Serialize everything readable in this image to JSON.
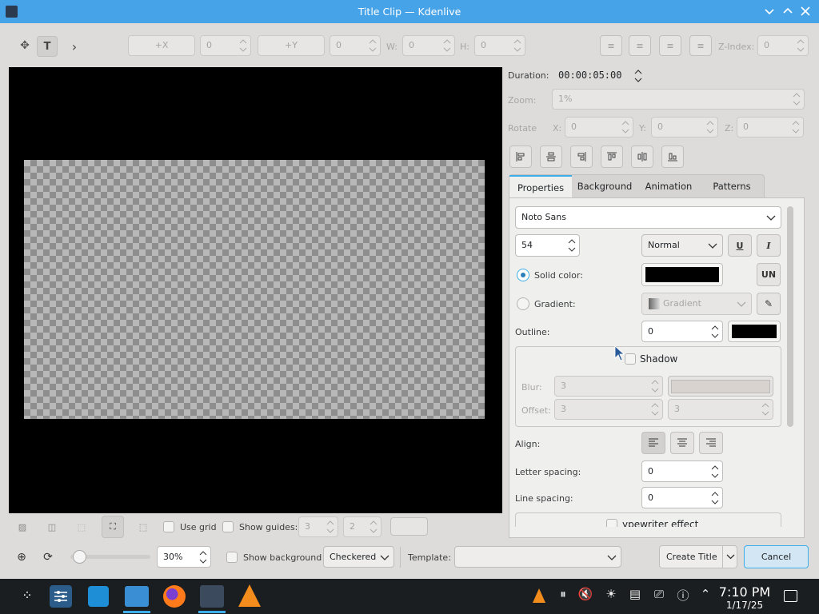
{
  "window": {
    "title": "Title Clip — Kdenlive"
  },
  "toolbar": {
    "plus_x": "+X",
    "x_value": "0",
    "plus_y": "+Y",
    "y_value": "0",
    "w_label": "W:",
    "w_value": "0",
    "h_label": "H:",
    "h_value": "0",
    "zindex_label": "Z-Index:",
    "zindex_value": "0"
  },
  "panel": {
    "duration_label": "Duration:",
    "duration_value": "00:00:05:00",
    "zoom_label": "Zoom:",
    "zoom_value": "1%",
    "rotate_label": "Rotate",
    "rx_label": "X:",
    "rx_value": "0",
    "ry_label": "Y:",
    "ry_value": "0",
    "rz_label": "Z:",
    "rz_value": "0",
    "tabs": [
      "Properties",
      "Background",
      "Animation",
      "Patterns"
    ],
    "font_family": "Noto Sans",
    "font_size": "54",
    "font_weight": "Normal",
    "solid_color_label": "Solid color:",
    "solid_color": "#000000",
    "gradient_label": "Gradient:",
    "gradient_value": "Gradient",
    "outline_label": "Outline:",
    "outline_value": "0",
    "outline_color": "#000000",
    "shadow_label": "Shadow",
    "blur_label": "Blur:",
    "blur_value": "3",
    "offset_label": "Offset:",
    "offset_x": "3",
    "offset_y": "3",
    "align_label": "Align:",
    "letter_spacing_label": "Letter spacing:",
    "letter_spacing_value": "0",
    "line_spacing_label": "Line spacing:",
    "line_spacing_value": "0",
    "typewriter_label": "ypewriter effect",
    "un_label": "UN"
  },
  "bottom": {
    "use_grid_label": "Use grid",
    "show_guides_label": "Show guides:",
    "guides_h": "3",
    "guides_v": "2",
    "zoom_value": "30%",
    "show_background_label": "Show background",
    "background_mode": "Checkered",
    "template_label": "Template:",
    "create_title": "Create Title",
    "cancel": "Cancel"
  },
  "taskbar": {
    "time": "7:10 PM",
    "date": "1/17/25"
  }
}
